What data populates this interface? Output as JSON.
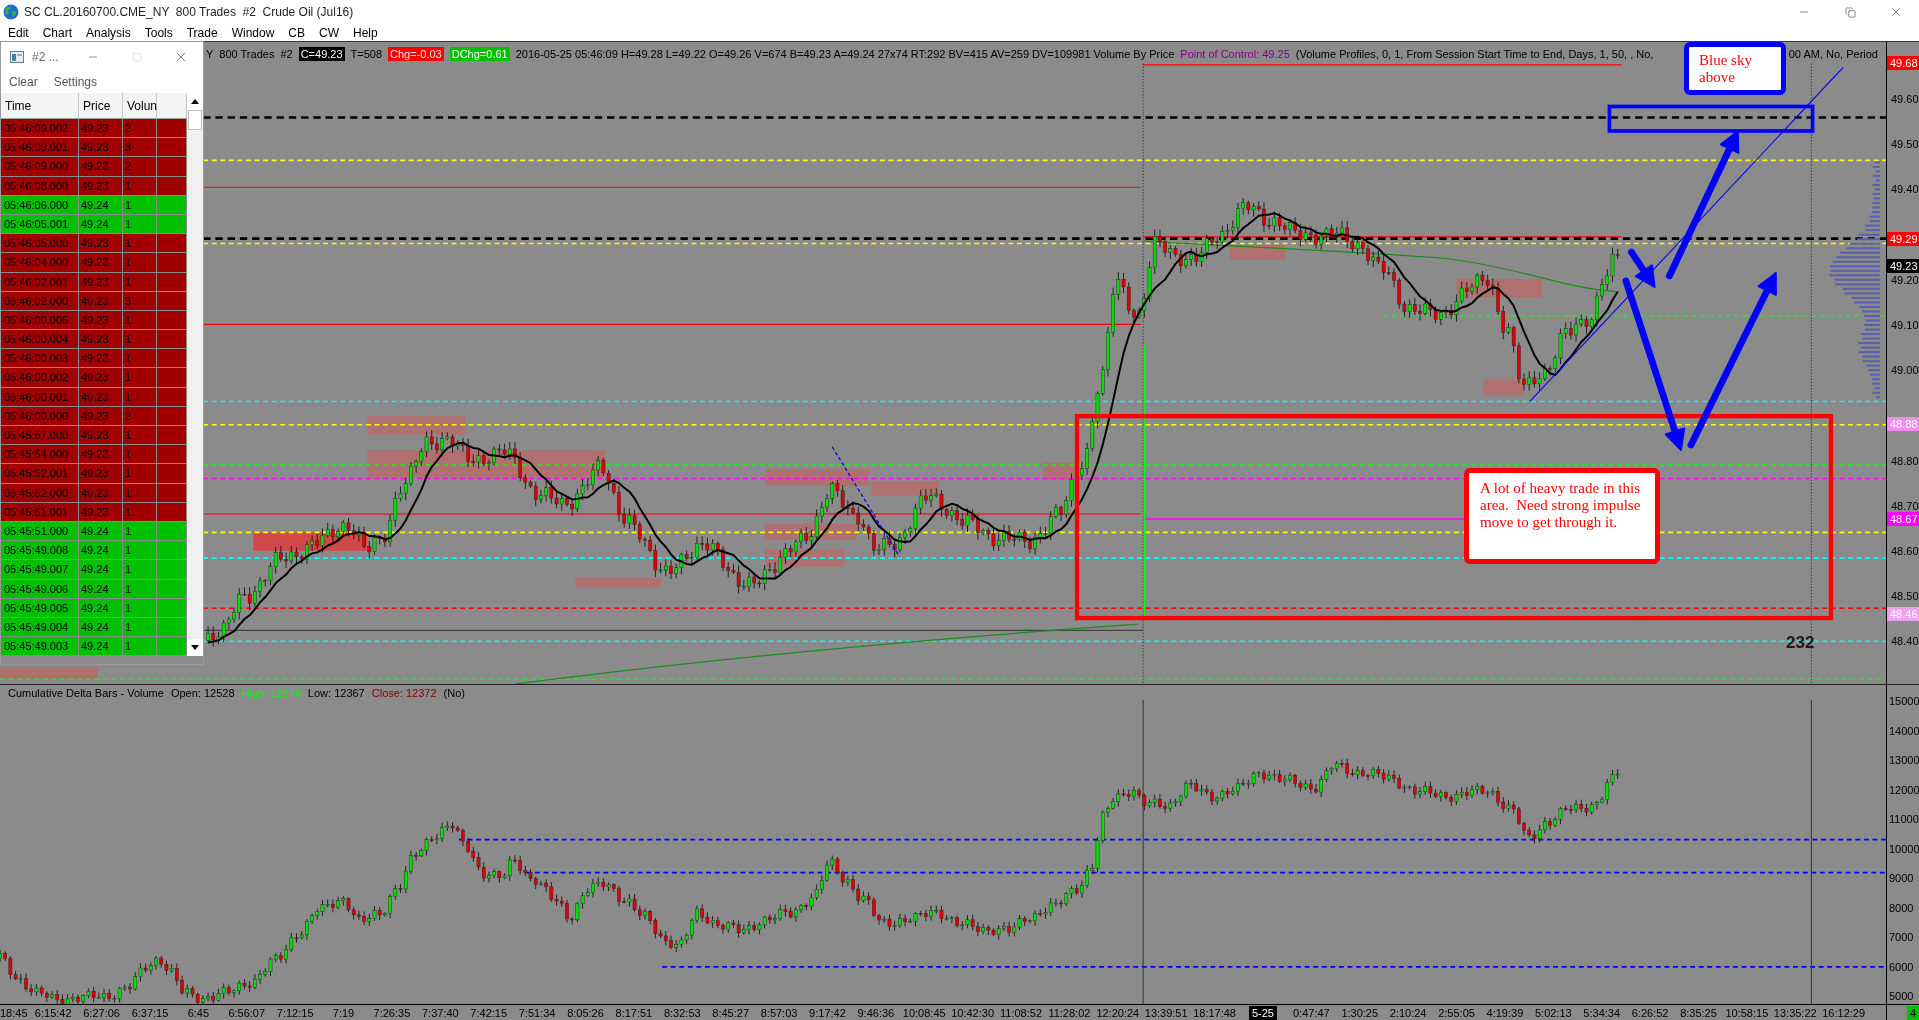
{
  "window": {
    "title": "SC CL.20160700.CME_NY  800 Trades  #2  Crude Oil (Jul16)"
  },
  "menu": [
    "Edit",
    "Chart",
    "Analysis",
    "Tools",
    "Trade",
    "Window",
    "CB",
    "CW",
    "Help"
  ],
  "chart": {
    "header": [
      {
        "kind": "plain",
        "text": "Y"
      },
      {
        "kind": "plain",
        "text": "800 Trades"
      },
      {
        "kind": "plain",
        "text": "#2"
      },
      {
        "kind": "inverse",
        "text": "C=49.23"
      },
      {
        "kind": "plain",
        "text": "T=508"
      },
      {
        "kind": "down",
        "text": "Chg=-0.03"
      },
      {
        "kind": "up",
        "text": "DChg=0.61"
      },
      {
        "kind": "plain",
        "text": "2016-05-25 05:46:09 H=49.28 L=49.22 O=49.26 V=674 B=49.23 A=49.24 27x74 RT:292 BV=415 AV=259 DV=109981 Volume By Price"
      },
      {
        "kind": "accent",
        "text": "Point of Control: 49.25"
      },
      {
        "kind": "plain",
        "text": "(Volume Profiles, 0, 1, From Session Start Time to End, Days, 1, 50, , No,"
      }
    ],
    "header_tail": "00 AM, No, Period",
    "price_axis": [
      {
        "kind": "tag",
        "text": "49.68",
        "color": "#ff0000"
      },
      {
        "kind": "tick",
        "text": "49.60"
      },
      {
        "kind": "tick",
        "text": "49.50"
      },
      {
        "kind": "tick",
        "text": "49.40"
      },
      {
        "kind": "tag",
        "text": "49.29",
        "color": "#ff0000"
      },
      {
        "kind": "tag",
        "text": "49.23",
        "color": "#000000"
      },
      {
        "kind": "tick",
        "text": "49.20"
      },
      {
        "kind": "tick",
        "text": "49.10"
      },
      {
        "kind": "tick",
        "text": "49.00"
      },
      {
        "kind": "tag",
        "text": "48.88",
        "color": "#f08cf0"
      },
      {
        "kind": "tick",
        "text": "48.80"
      },
      {
        "kind": "tick",
        "text": "48.70"
      },
      {
        "kind": "tag",
        "text": "48.67",
        "color": "#ff00ff"
      },
      {
        "kind": "tick",
        "text": "48.60"
      },
      {
        "kind": "tick",
        "text": "48.50"
      },
      {
        "kind": "tag",
        "text": "48.46",
        "color": "#f0a0f0"
      },
      {
        "kind": "tick",
        "text": "48.40"
      }
    ],
    "notes": [
      {
        "text": "Blue sky above",
        "color": "#0000ff"
      },
      {
        "text": "A lot of heavy trade in this area.  Need strong impulse move to get through it.",
        "color": "#ff0000"
      }
    ],
    "counter": "232",
    "lower_pane": {
      "header": [
        {
          "kind": "plain",
          "text": "Cumulative Delta Bars - Volume"
        },
        {
          "kind": "plain",
          "text": "Open: 12528"
        },
        {
          "kind": "up",
          "text": "High: 12674"
        },
        {
          "kind": "plain",
          "text": "Low: 12367"
        },
        {
          "kind": "down",
          "text": "Close: 12372"
        },
        {
          "kind": "plain",
          "text": "(No)"
        }
      ],
      "axis": [
        "15000",
        "14000",
        "13000",
        "12000",
        "11000",
        "10000",
        "9000",
        "8000",
        "7000",
        "6000",
        "5000"
      ]
    },
    "time_axis": [
      {
        "kind": "time",
        "text": "18:45"
      },
      {
        "kind": "time",
        "text": "6:15:42"
      },
      {
        "kind": "time",
        "text": "6:27:06"
      },
      {
        "kind": "time",
        "text": "6:37:15"
      },
      {
        "kind": "time",
        "text": "6:45"
      },
      {
        "kind": "time",
        "text": "6:56:07"
      },
      {
        "kind": "time",
        "text": "7:12:15"
      },
      {
        "kind": "time",
        "text": "7:19"
      },
      {
        "kind": "time",
        "text": "7:26:35"
      },
      {
        "kind": "time",
        "text": "7:37:40"
      },
      {
        "kind": "time",
        "text": "7:42:15"
      },
      {
        "kind": "time",
        "text": "7:51:34"
      },
      {
        "kind": "time",
        "text": "8:05:26"
      },
      {
        "kind": "time",
        "text": "8:17:51"
      },
      {
        "kind": "time",
        "text": "8:32:53"
      },
      {
        "kind": "time",
        "text": "8:45:27"
      },
      {
        "kind": "time",
        "text": "8:57:03"
      },
      {
        "kind": "time",
        "text": "9:17:42"
      },
      {
        "kind": "time",
        "text": "9:46:36"
      },
      {
        "kind": "time",
        "text": "10:08:45"
      },
      {
        "kind": "time",
        "text": "10:42:30"
      },
      {
        "kind": "time",
        "text": "11:08:52"
      },
      {
        "kind": "time",
        "text": "11:28:02"
      },
      {
        "kind": "time",
        "text": "12:20:24"
      },
      {
        "kind": "time",
        "text": "13:39:51"
      },
      {
        "kind": "time",
        "text": "18:17:48"
      },
      {
        "kind": "date",
        "text": "5-25"
      },
      {
        "kind": "time",
        "text": "0:47:47"
      },
      {
        "kind": "time",
        "text": "1:30:25"
      },
      {
        "kind": "time",
        "text": "2:10:24"
      },
      {
        "kind": "time",
        "text": "2:55:05"
      },
      {
        "kind": "time",
        "text": "4:19:39"
      },
      {
        "kind": "time",
        "text": "5:02:13"
      },
      {
        "kind": "time",
        "text": "5:34:34"
      },
      {
        "kind": "time",
        "text": "6:26:52"
      },
      {
        "kind": "time",
        "text": "8:35:25"
      },
      {
        "kind": "time",
        "text": "10:58:15"
      },
      {
        "kind": "time",
        "text": "13:35:22"
      },
      {
        "kind": "time",
        "text": "16:12:29"
      }
    ],
    "corner": "4"
  },
  "time_and_sales": {
    "title": "#2 ...",
    "menu": [
      "Clear",
      "Settings"
    ],
    "columns": [
      "Time",
      "Price",
      "Volun"
    ],
    "rows": [
      {
        "time": "05:46:09.002",
        "price": "49.23",
        "volume": "2",
        "color": "#a00000"
      },
      {
        "time": "05:46:09.001",
        "price": "49.23",
        "volume": "3",
        "color": "#a00000"
      },
      {
        "time": "05:46:09.000",
        "price": "49.23",
        "volume": "2",
        "color": "#a00000"
      },
      {
        "time": "05:46:08.000",
        "price": "49.23",
        "volume": "1",
        "color": "#a00000"
      },
      {
        "time": "05:46:06.000",
        "price": "49.24",
        "volume": "1",
        "color": "#00c000"
      },
      {
        "time": "05:46:05.001",
        "price": "49.24",
        "volume": "1",
        "color": "#00c000"
      },
      {
        "time": "05:46:05.000",
        "price": "49.23",
        "volume": "1",
        "color": "#a00000"
      },
      {
        "time": "05:46:04.000",
        "price": "49.23",
        "volume": "1",
        "color": "#a00000"
      },
      {
        "time": "05:46:02.001",
        "price": "49.23",
        "volume": "1",
        "color": "#a00000"
      },
      {
        "time": "05:46:02.000",
        "price": "49.23",
        "volume": "3",
        "color": "#a00000"
      },
      {
        "time": "05:46:00.005",
        "price": "49.23",
        "volume": "1",
        "color": "#a00000"
      },
      {
        "time": "05:46:00.004",
        "price": "49.23",
        "volume": "1",
        "color": "#a00000"
      },
      {
        "time": "05:46:00.003",
        "price": "49.23",
        "volume": "1",
        "color": "#a00000"
      },
      {
        "time": "05:46:00.002",
        "price": "49.23",
        "volume": "1",
        "color": "#a00000"
      },
      {
        "time": "05:46:00.001",
        "price": "49.23",
        "volume": "1",
        "color": "#a00000"
      },
      {
        "time": "05:46:00.000",
        "price": "49.23",
        "volume": "2",
        "color": "#a00000"
      },
      {
        "time": "05:45:57.000",
        "price": "49.23",
        "volume": "1",
        "color": "#a00000"
      },
      {
        "time": "05:45:54.000",
        "price": "49.23",
        "volume": "1",
        "color": "#a00000"
      },
      {
        "time": "05:45:52.001",
        "price": "49.23",
        "volume": "1",
        "color": "#a00000"
      },
      {
        "time": "05:45:52.000",
        "price": "49.23",
        "volume": "1",
        "color": "#a00000"
      },
      {
        "time": "05:45:51.001",
        "price": "49.23",
        "volume": "1",
        "color": "#a00000"
      },
      {
        "time": "05:45:51.000",
        "price": "49.24",
        "volume": "1",
        "color": "#00c000"
      },
      {
        "time": "05:45:49.008",
        "price": "49.24",
        "volume": "1",
        "color": "#00c000"
      },
      {
        "time": "05:45:49.007",
        "price": "49.24",
        "volume": "1",
        "color": "#00c000"
      },
      {
        "time": "05:45:49.006",
        "price": "49.24",
        "volume": "1",
        "color": "#00c000"
      },
      {
        "time": "05:45:49.005",
        "price": "49.24",
        "volume": "1",
        "color": "#00c000"
      },
      {
        "time": "05:45:49.004",
        "price": "49.24",
        "volume": "1",
        "color": "#00c000"
      },
      {
        "time": "05:45:49.003",
        "price": "49.24",
        "volume": "1",
        "color": "#00c000"
      }
    ]
  }
}
